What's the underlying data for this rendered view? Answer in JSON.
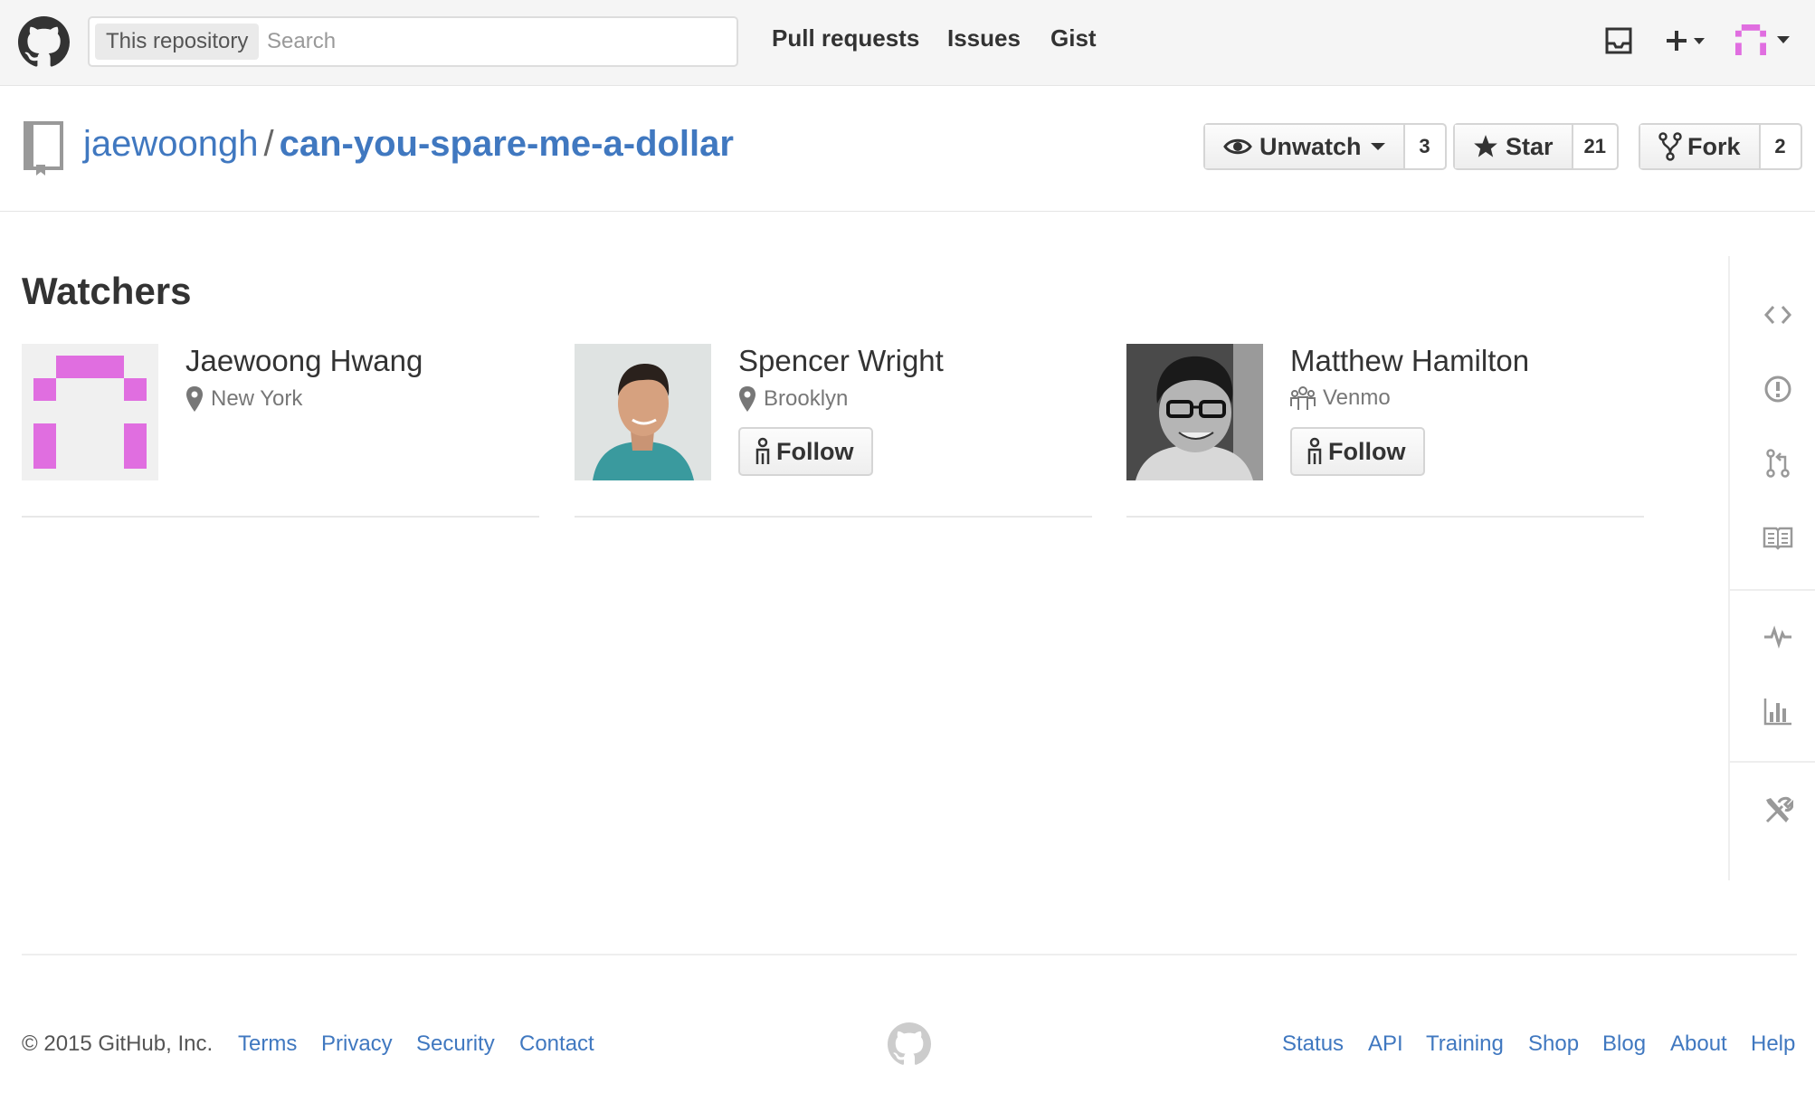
{
  "header": {
    "search_scope": "This repository",
    "search_placeholder": "Search",
    "nav": [
      "Pull requests",
      "Issues",
      "Gist"
    ]
  },
  "repo": {
    "owner": "jaewoongh",
    "separator": "/",
    "name": "can-you-spare-me-a-dollar",
    "watch_label": "Unwatch",
    "watch_count": "3",
    "star_label": "Star",
    "star_count": "21",
    "fork_label": "Fork",
    "fork_count": "2"
  },
  "page_title": "Watchers",
  "watchers": [
    {
      "name": "Jaewoong Hwang",
      "detail": "New York",
      "detail_icon": "location-icon",
      "follow_label": ""
    },
    {
      "name": "Spencer Wright",
      "detail": "Brooklyn",
      "detail_icon": "location-icon",
      "follow_label": "Follow"
    },
    {
      "name": "Matthew Hamilton",
      "detail": "Venmo",
      "detail_icon": "organization-icon",
      "follow_label": "Follow"
    }
  ],
  "sidebar_icons": [
    "code-icon",
    "issue-icon",
    "pull-request-icon",
    "wiki-icon",
    "pulse-icon",
    "graph-icon",
    "settings-icon"
  ],
  "footer": {
    "copyright": "© 2015 GitHub, Inc.",
    "left_links": [
      "Terms",
      "Privacy",
      "Security",
      "Contact"
    ],
    "right_links": [
      "Status",
      "API",
      "Training",
      "Shop",
      "Blog",
      "About",
      "Help"
    ]
  },
  "colors": {
    "link": "#4078c0",
    "identicon": "#e06ee0",
    "header_bg": "#f5f5f5"
  }
}
